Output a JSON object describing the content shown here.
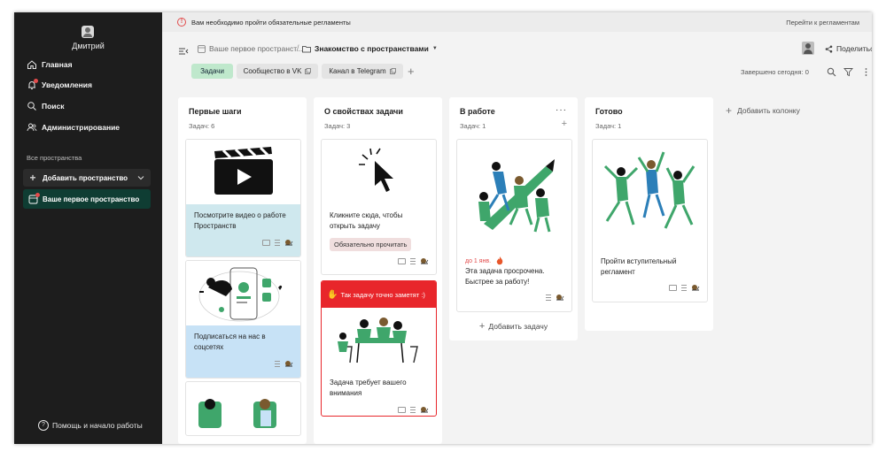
{
  "user": {
    "name": "Дмитрий"
  },
  "nav": {
    "home": "Главная",
    "notifications": "Уведомления",
    "search": "Поиск",
    "admin": "Администрирование"
  },
  "spaces": {
    "section_title": "Все пространства",
    "add_label": "Добавить пространство",
    "current_label": "Ваше первое пространство"
  },
  "help": "Помощь и начало работы",
  "banner": {
    "message": "Вам необходимо пройти обязательные регламенты",
    "link": "Перейти к регламентам"
  },
  "breadcrumb": {
    "space": "Ваше первое пространст...",
    "separator": "/",
    "board": "Знакомство с пространствами"
  },
  "header": {
    "share": "Поделиться"
  },
  "tabs": [
    {
      "label": "Задачи"
    },
    {
      "label": "Сообщество в VK"
    },
    {
      "label": "Канал в Telegram"
    }
  ],
  "toolbar": {
    "done_today": "Завершено сегодня: 0"
  },
  "columns": [
    {
      "title": "Первые шаги",
      "count": "Задач: 6",
      "cards": [
        {
          "text": "Посмотрите видео о работе Пространств"
        },
        {
          "text": "Подписаться на нас в соцсетях"
        },
        {
          "text": ""
        }
      ]
    },
    {
      "title": "О свойствах задачи",
      "count": "Задач: 3",
      "cards": [
        {
          "text": "Кликните сюда, чтобы открыть задачу",
          "tag": "Обязательно прочитать"
        },
        {
          "banner": "Так задачу точно заметят :)",
          "text": "Задача требует вашего внимания"
        }
      ]
    },
    {
      "title": "В работе",
      "count": "Задач: 1",
      "more": "···",
      "cards": [
        {
          "due": "до 1 янв.",
          "text": "Эта задача просрочена. Быстрее за работу!"
        }
      ],
      "add_task": "Добавить задачу"
    },
    {
      "title": "Готово",
      "count": "Задач: 1",
      "cards": [
        {
          "text": "Пройти вступительный регламент"
        }
      ]
    }
  ],
  "add_column": "Добавить колонку",
  "colors": {
    "sidebar_bg": "#1d1d1d",
    "space_active": "#0f3d33",
    "tab_active": "#bfe8cc",
    "accent_green": "#3fa66b",
    "card_blue": "#cfe8ee",
    "card_light_blue": "#c7e2f6",
    "flag_red": "#e8262b",
    "alert_red": "#e24b4b"
  },
  "icons": [
    "home-icon",
    "bell-icon",
    "search-icon",
    "admin-icon",
    "plus-icon",
    "chevron-down-icon",
    "space-icon",
    "help-icon",
    "alert-icon",
    "collapse-icon",
    "folder-icon",
    "share-icon",
    "external-link-icon",
    "filter-icon",
    "kebab-icon",
    "comment-icon",
    "description-icon",
    "snail-icon",
    "fire-icon",
    "hand-icon"
  ]
}
